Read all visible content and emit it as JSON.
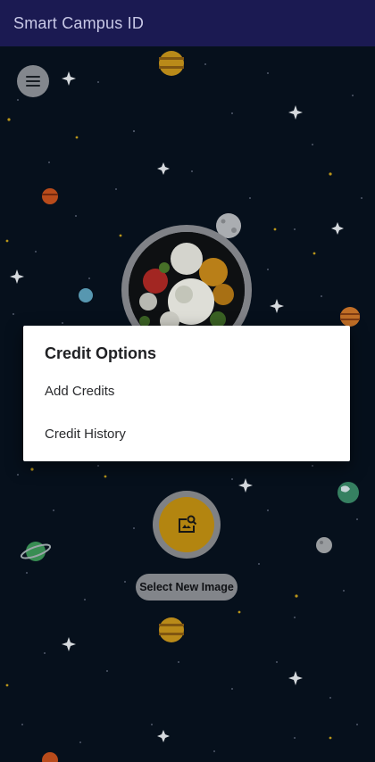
{
  "app": {
    "title": "Smart Campus ID"
  },
  "dialog": {
    "title": "Credit Options",
    "items": [
      "Add Credits",
      "Credit History"
    ]
  },
  "actions": {
    "select_image_label": "Select New Image"
  },
  "icons": {
    "menu": "hamburger-menu-icon",
    "image_search": "image-search-icon"
  },
  "colors": {
    "appbar": "#1b1a52",
    "space_bg": "#07121f",
    "fab_accent": "#c39112",
    "dialog_bg": "#ffffff"
  }
}
